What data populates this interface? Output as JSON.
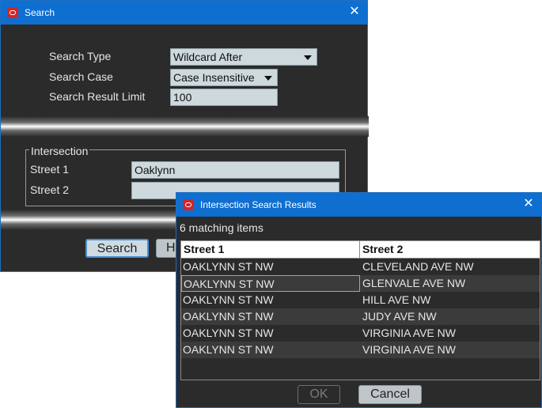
{
  "search_dialog": {
    "title": "Search",
    "fields": {
      "search_type": {
        "label": "Search Type",
        "value": "Wildcard After"
      },
      "search_case": {
        "label": "Search Case",
        "value": "Case Insensitive"
      },
      "result_limit": {
        "label": "Search Result Limit",
        "value": "100"
      }
    },
    "intersection": {
      "group_label": "Intersection",
      "street1": {
        "label": "Street 1",
        "value": "Oaklynn"
      },
      "street2": {
        "label": "Street 2",
        "value": ""
      }
    },
    "buttons": {
      "search": "Search",
      "help_partial": "H"
    }
  },
  "results_dialog": {
    "title": "Intersection Search Results",
    "count_text": "6 matching items",
    "columns": [
      "Street 1",
      "Street 2"
    ],
    "rows": [
      [
        "OAKLYNN ST NW",
        "CLEVELAND AVE NW"
      ],
      [
        "OAKLYNN ST NW",
        "GLENVALE AVE NW"
      ],
      [
        "OAKLYNN ST NW",
        "HILL AVE NW"
      ],
      [
        "OAKLYNN ST NW",
        "JUDY AVE NW"
      ],
      [
        "OAKLYNN ST NW",
        "VIRGINIA AVE NW"
      ],
      [
        "OAKLYNN ST NW",
        "VIRGINIA AVE NW"
      ]
    ],
    "buttons": {
      "ok": "OK",
      "cancel": "Cancel"
    }
  },
  "colors": {
    "titlebar": "#0e6fd1",
    "window_bg": "#2b2b2b",
    "selection_border": "#d8a032"
  },
  "icons": {
    "app": "oracle-logo-icon",
    "close": "close-icon",
    "dropdown": "chevron-down-icon"
  }
}
